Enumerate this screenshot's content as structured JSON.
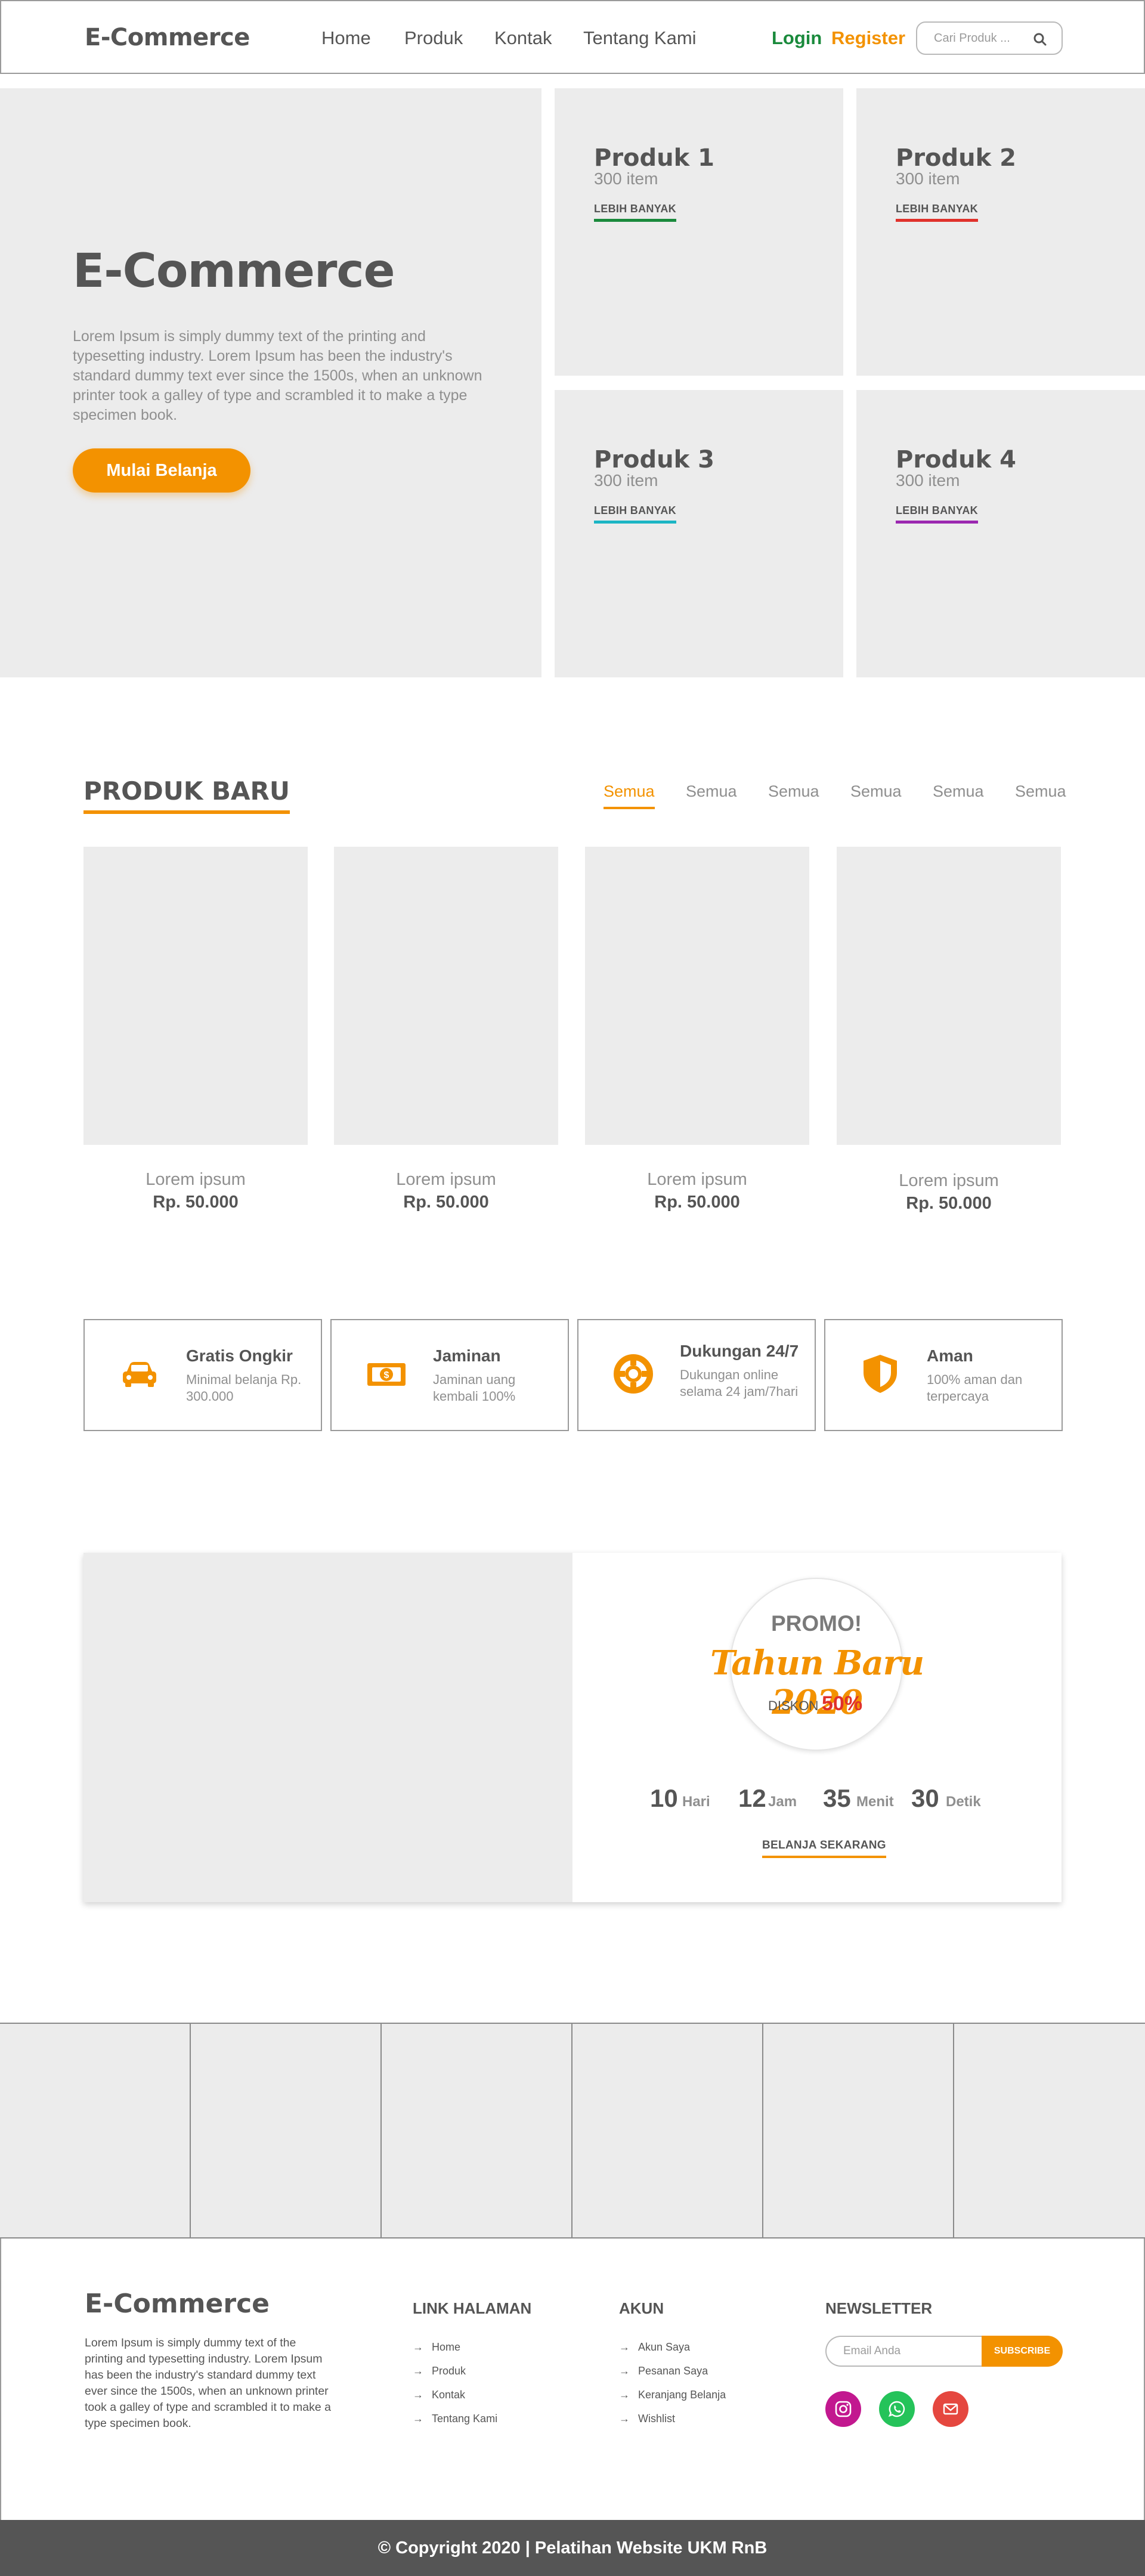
{
  "header": {
    "brand": "E-Commerce",
    "nav": [
      "Home",
      "Produk",
      "Kontak",
      "Tentang Kami"
    ],
    "login": "Login",
    "register": "Register",
    "search_placeholder": "Cari Produk ..."
  },
  "hero": {
    "title": "E-Commerce",
    "text": "Lorem Ipsum is simply dummy text of the printing and typesetting industry. Lorem Ipsum has been the industry's standard dummy text ever since the 1500s, when an unknown printer took a galley of type and scrambled it to make a type specimen book.",
    "button": "Mulai Belanja"
  },
  "categories": [
    {
      "title": "Produk 1",
      "count": "300 item",
      "link": "LEBIH BANYAK",
      "color": "#1a8a3c"
    },
    {
      "title": "Produk 2",
      "count": "300 item",
      "link": "LEBIH BANYAK",
      "color": "#e0312b"
    },
    {
      "title": "Produk 3",
      "count": "300 item",
      "link": "LEBIH BANYAK",
      "color": "#1bb5c4"
    },
    {
      "title": "Produk 4",
      "count": "300 item",
      "link": "LEBIH BANYAK",
      "color": "#9b27b0"
    }
  ],
  "new_products": {
    "title": "PRODUK BARU",
    "filters": [
      "Semua",
      "Semua",
      "Semua",
      "Semua",
      "Semua",
      "Semua"
    ],
    "items": [
      {
        "name": "Lorem ipsum",
        "price": "Rp. 50.000"
      },
      {
        "name": "Lorem ipsum",
        "price": "Rp. 50.000"
      },
      {
        "name": "Lorem ipsum",
        "price": "Rp. 50.000"
      },
      {
        "name": "Lorem ipsum",
        "price": "Rp. 50.000"
      }
    ]
  },
  "features": [
    {
      "icon": "car-icon",
      "title": "Gratis Ongkir",
      "desc": "Minimal belanja Rp. 300.000"
    },
    {
      "icon": "money-icon",
      "title": "Jaminan",
      "desc": "Jaminan uang kembali 100%"
    },
    {
      "icon": "lifebuoy-icon",
      "title": "Dukungan 24/7",
      "desc": "Dukungan online selama 24 jam/7hari"
    },
    {
      "icon": "shield-icon",
      "title": "Aman",
      "desc": "100% aman dan terpercaya"
    }
  ],
  "promo": {
    "label": "PROMO!",
    "title": "Tahun Baru 2020",
    "discount_label": "DISKON",
    "discount_value": "50%",
    "countdown": [
      {
        "value": "10",
        "unit": "Hari"
      },
      {
        "value": "12",
        "unit": "Jam"
      },
      {
        "value": "35",
        "unit": "Menit"
      },
      {
        "value": "30",
        "unit": "Detik"
      }
    ],
    "link": "BELANJA SEKARANG"
  },
  "footer": {
    "brand": "E-Commerce",
    "text": "Lorem Ipsum is simply dummy text of the printing and typesetting industry. Lorem Ipsum has been the industry's standard dummy text ever since the 1500s, when an unknown printer took a galley of type and scrambled it to make a type specimen book.",
    "links_title": "LINK HALAMAN",
    "links": [
      "Home",
      "Produk",
      "Kontak",
      "Tentang Kami"
    ],
    "account_title": "AKUN",
    "account": [
      "Akun Saya",
      "Pesanan Saya",
      "Keranjang Belanja",
      "Wishlist"
    ],
    "newsletter_title": "NEWSLETTER",
    "email_placeholder": "Email Anda",
    "subscribe": "SUBSCRIBE",
    "social": [
      "instagram-icon",
      "whatsapp-icon",
      "mail-icon"
    ],
    "colors": {
      "instagram": "#c2188f",
      "whatsapp": "#25c35a",
      "mail": "#e5473f"
    }
  },
  "copyright": "© Copyright 2020 | Pelatihan Website UKM RnB"
}
